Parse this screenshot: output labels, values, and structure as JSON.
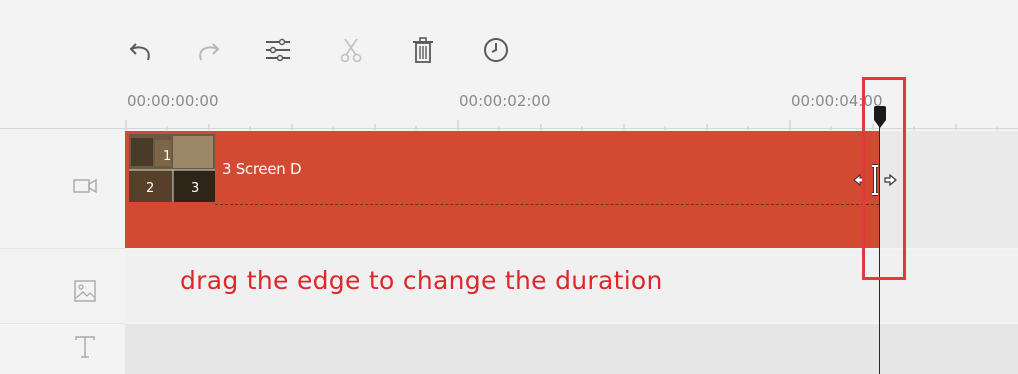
{
  "toolbar": {
    "buttons": [
      {
        "name": "undo-icon",
        "enabled": true
      },
      {
        "name": "redo-icon",
        "enabled": false
      },
      {
        "name": "adjust-icon",
        "enabled": true
      },
      {
        "name": "cut-icon",
        "enabled": false
      },
      {
        "name": "delete-icon",
        "enabled": true
      },
      {
        "name": "clock-icon",
        "enabled": true
      }
    ]
  },
  "ruler": {
    "labels": [
      "00:00:00:00",
      "00:00:02:00",
      "00:00:04:00"
    ]
  },
  "tracks": [
    {
      "name": "video-track",
      "icon": "video-camera-icon"
    },
    {
      "name": "image-track",
      "icon": "image-icon"
    },
    {
      "name": "text-track",
      "icon": "text-icon"
    }
  ],
  "clip": {
    "name": "3 Screen D",
    "color": "#d34a32",
    "thumbnail_numbers": [
      "1",
      "2",
      "3"
    ]
  },
  "caption": {
    "text": "drag the edge to change the duration",
    "color": "#e2252b"
  },
  "highlight": {
    "color": "#e03a3e"
  }
}
